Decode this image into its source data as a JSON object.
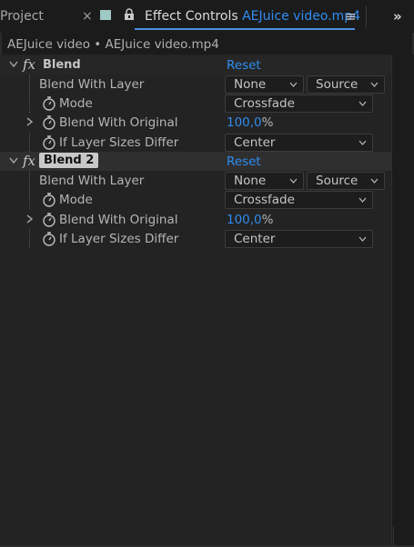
{
  "tabs": {
    "project_label": "Project",
    "close_glyph": "×",
    "effect_controls_label": "Effect Controls",
    "effect_controls_file": "AEJuice video.mp4",
    "menu_glyph": "≡",
    "more_glyph": "»"
  },
  "breadcrumb": "AEJuice video • AEJuice video.mp4",
  "effects": [
    {
      "name": "Blend",
      "fx_label": "fx",
      "reset_label": "Reset",
      "props": {
        "blend_with_layer_label": "Blend With Layer",
        "blend_with_layer_value": "None",
        "blend_with_layer_source": "Source",
        "mode_label": "Mode",
        "mode_value": "Crossfade",
        "blend_with_original_label": "Blend With Original",
        "blend_with_original_value": "100,0",
        "blend_with_original_unit": "%",
        "if_layer_sizes_label": "If Layer Sizes Differ",
        "if_layer_sizes_value": "Center"
      }
    },
    {
      "name": "Blend 2",
      "fx_label": "fx",
      "reset_label": "Reset",
      "props": {
        "blend_with_layer_label": "Blend With Layer",
        "blend_with_layer_value": "None",
        "blend_with_layer_source": "Source",
        "mode_label": "Mode",
        "mode_value": "Crossfade",
        "blend_with_original_label": "Blend With Original",
        "blend_with_original_value": "100,0",
        "blend_with_original_unit": "%",
        "if_layer_sizes_label": "If Layer Sizes Differ",
        "if_layer_sizes_value": "Center"
      }
    }
  ],
  "colors": {
    "accent_blue": "#2f8cf0",
    "panel_bg": "#232323",
    "tab_swatch": "#9fc9c4"
  },
  "icons": [
    "close-icon",
    "lock-icon",
    "panel-menu-icon",
    "overflow-chevrons-icon",
    "fx-icon",
    "stopwatch-icon",
    "chevron-down-icon",
    "chevron-right-icon",
    "dropdown-caret-icon"
  ]
}
